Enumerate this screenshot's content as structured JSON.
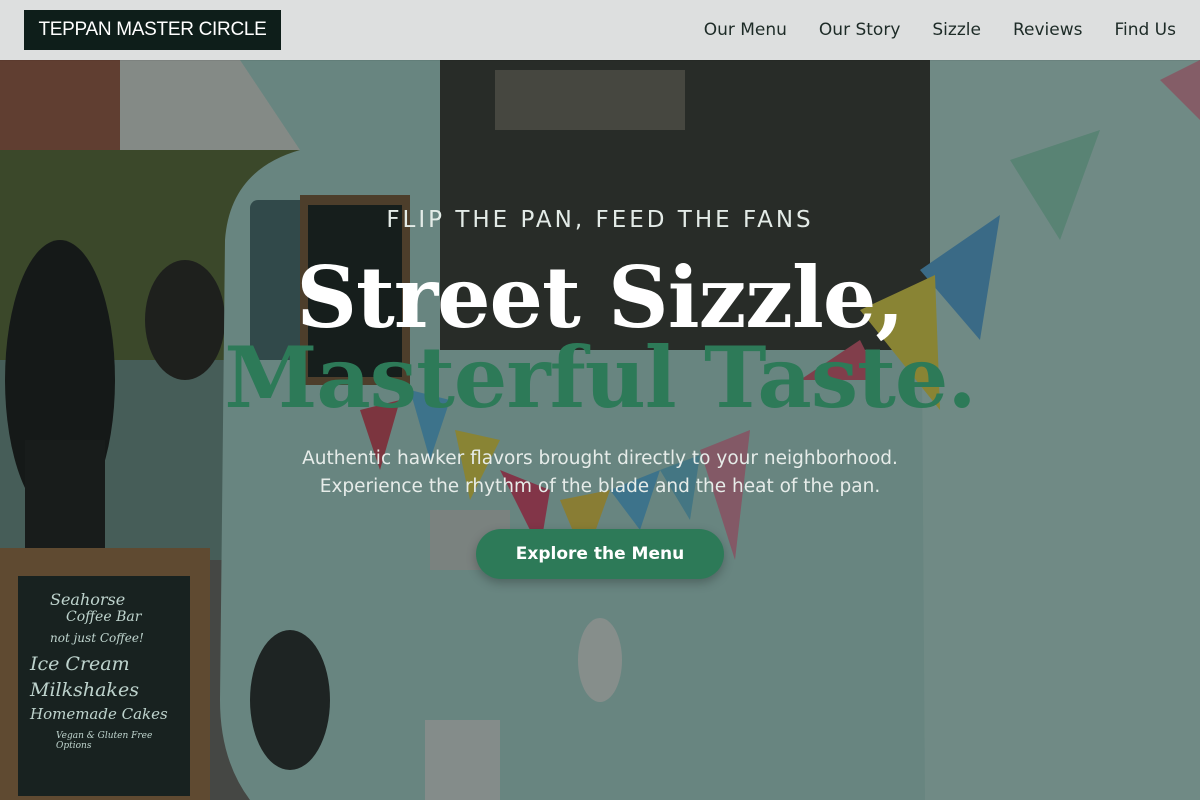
{
  "brand": {
    "name": "TEPPAN MASTER CIRCLE"
  },
  "nav": {
    "items": [
      "Our Menu",
      "Our Story",
      "Sizzle",
      "Reviews",
      "Find Us"
    ]
  },
  "hero": {
    "eyebrow": "FLIP THE PAN, FEED THE FANS",
    "headline_line1": "Street Sizzle,",
    "headline_line2": "Masterful Taste.",
    "subtitle_line1": "Authentic hawker flavors brought directly to your neighborhood.",
    "subtitle_line2": "Experience the rhythm of the blade and the heat of the pan.",
    "cta_label": "Explore the Menu"
  },
  "chalkboard": {
    "lines": [
      "Seahorse",
      "Coffee Bar",
      "not just Coffee!",
      "Ice Cream",
      "Milkshakes",
      "Homemade Cakes",
      "Vegan & Gluten Free Options"
    ]
  },
  "colors": {
    "accent": "#2d7a58",
    "brand_bg": "#0e1e1a",
    "nav_bg": "#e8eae9"
  }
}
